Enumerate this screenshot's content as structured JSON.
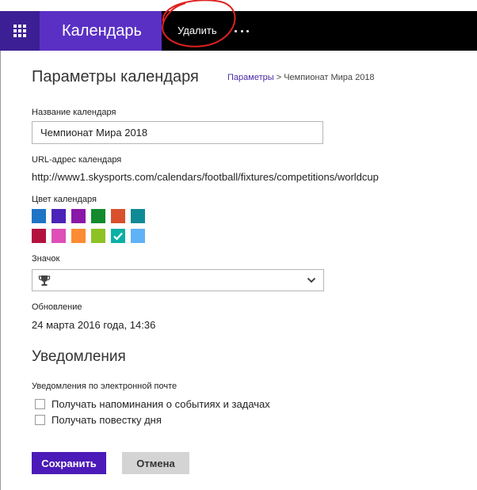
{
  "header": {
    "app_name": "Календарь",
    "delete_label": "Удалить",
    "app_bar_color": "#5a30c4",
    "waffle_color": "#3c1f94",
    "annotation_color": "#e02020"
  },
  "page": {
    "title": "Параметры календаря",
    "breadcrumb": {
      "parent": "Параметры",
      "separator": ">",
      "current": "Чемпионат Мира 2018"
    }
  },
  "form": {
    "name_label": "Название календаря",
    "name_value": "Чемпионат Мира 2018",
    "url_label": "URL-адрес календаря",
    "url_value": "http://www1.skysports.com/calendars/football/fixtures/competitions/worldcup",
    "color_label": "Цвет календаря",
    "colors": [
      "#1f74c6",
      "#4b23b8",
      "#8a17a8",
      "#138a2d",
      "#d9512c",
      "#0f8a96",
      "#b3123f",
      "#de4fb8",
      "#fb8c34",
      "#8dc226",
      "#0ab0a4",
      "#5fb2f5"
    ],
    "selected_color_index": 10,
    "icon_label": "Значок",
    "icon_selected": "trophy-icon",
    "updated_label": "Обновление",
    "updated_value": "24 марта 2016 года, 14:36"
  },
  "notifications": {
    "title": "Уведомления",
    "email_label": "Уведомления по электронной почте",
    "options": [
      {
        "label": "Получать напоминания о событиях и задачах",
        "checked": false
      },
      {
        "label": "Получать повестку дня",
        "checked": false
      }
    ]
  },
  "buttons": {
    "save": "Сохранить",
    "cancel": "Отмена",
    "save_color": "#4b1ab8"
  }
}
